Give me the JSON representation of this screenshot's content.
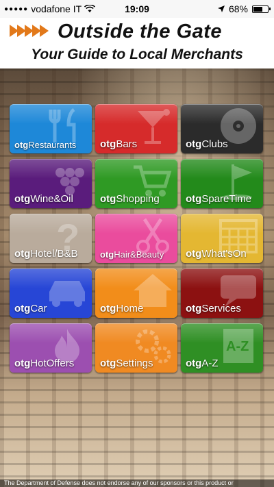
{
  "status_bar": {
    "carrier": "vodafone IT",
    "time": "19:09",
    "battery": "68%",
    "battery_level": 0.68
  },
  "header": {
    "title": "Outside the Gate",
    "subtitle": "Your Guide to Local Merchants"
  },
  "tiles": [
    {
      "prefix": "otg",
      "name": "Restaurants",
      "color": "#1e88d8",
      "icon": "fork-knife-icon"
    },
    {
      "prefix": "otg",
      "name": "Bars",
      "color": "#d62b2b",
      "icon": "martini-icon"
    },
    {
      "prefix": "otg",
      "name": "Clubs",
      "color": "#2b2b2b",
      "icon": "vinyl-record-icon"
    },
    {
      "prefix": "otg",
      "name": "Wine&Oil",
      "color": "#5a1c7c",
      "icon": "grapes-icon"
    },
    {
      "prefix": "otg",
      "name": "Shopping",
      "color": "#2f9a24",
      "icon": "shopping-cart-icon"
    },
    {
      "prefix": "otg",
      "name": "SpareTime",
      "color": "#238a1b",
      "icon": "golf-flag-icon"
    },
    {
      "prefix": "otg",
      "name": "Hotel/B&B",
      "color": "#b9ab9c",
      "icon": "question-mark-icon"
    },
    {
      "prefix": "otg",
      "name": "Hair&Beauty",
      "color": "#ea4c9d",
      "icon": "scissors-icon"
    },
    {
      "prefix": "otg",
      "name": "What'sOn",
      "color": "#e4b732",
      "icon": "calendar-icon"
    },
    {
      "prefix": "otg",
      "name": "Car",
      "color": "#2746d6",
      "icon": "car-icon"
    },
    {
      "prefix": "otg",
      "name": "Home",
      "color": "#f28d1a",
      "icon": "house-icon"
    },
    {
      "prefix": "otg",
      "name": "Services",
      "color": "#8c1111",
      "icon": "chat-bubble-icon"
    },
    {
      "prefix": "otg",
      "name": "HotOffers",
      "color": "#9c4fb0",
      "icon": "flame-icon"
    },
    {
      "prefix": "otg",
      "name": "Settings",
      "color": "#f08a22",
      "icon": "gears-icon"
    },
    {
      "prefix": "otg",
      "name": "A-Z",
      "color": "#2f8f24",
      "icon": "a-z-book-icon"
    }
  ],
  "footer": {
    "text": "The Department of Defense does not endorse any of our sponsors or this product or"
  }
}
